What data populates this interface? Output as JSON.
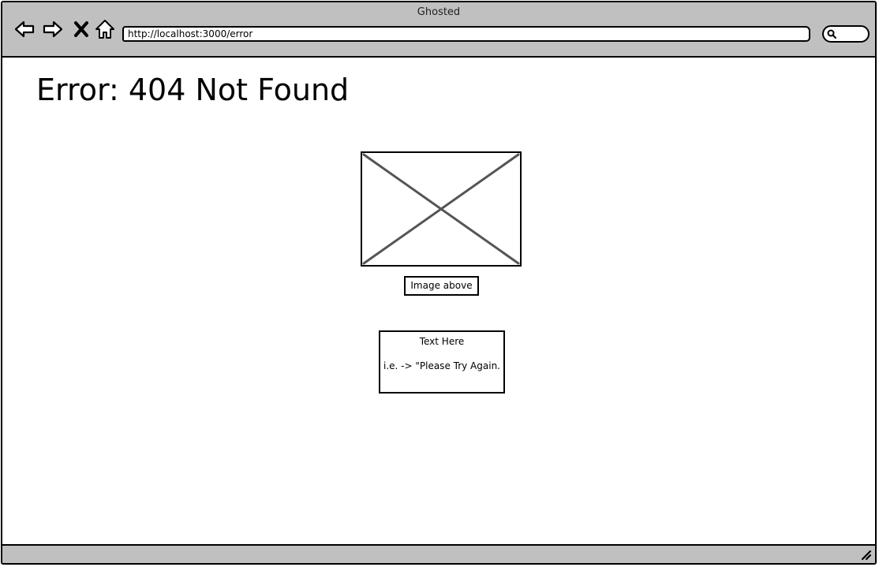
{
  "window": {
    "title": "Ghosted"
  },
  "toolbar": {
    "back_icon": "back-arrow-icon",
    "forward_icon": "forward-arrow-icon",
    "stop_icon": "close-x-icon",
    "home_icon": "home-icon",
    "url": "http://localhost:3000/error",
    "search_icon": "search-icon"
  },
  "page": {
    "heading": "Error: 404 Not Found",
    "image_placeholder_icon": "image-placeholder-icon",
    "image_caption": "Image above",
    "message_title": "Text Here",
    "message_body": "i.e. -> \"Please Try Again."
  },
  "statusbar": {
    "resize_icon": "resize-grip-icon"
  },
  "colors": {
    "chrome_gray": "#c0c0c0",
    "border": "#000000",
    "placeholder_stroke": "#555555"
  }
}
